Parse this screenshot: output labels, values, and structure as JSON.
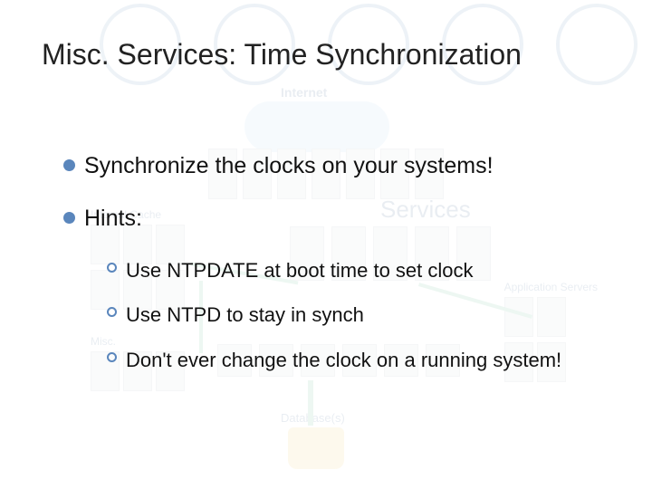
{
  "title": "Misc. Services: Time Synchronization",
  "bullets": {
    "a": "Synchronize the clocks on your systems!",
    "b": "Hints:"
  },
  "hints": {
    "a": "Use NTPDATE at boot time to set clock",
    "b": "Use NTPD to stay in synch",
    "c": "Don't ever change the clock on a running system!"
  },
  "bg": {
    "internet": "Internet",
    "internal_cache": "Internal Cache",
    "misc": "Misc.",
    "services": "Services",
    "app_servers": "Application Servers",
    "databases": "Database(s)"
  }
}
